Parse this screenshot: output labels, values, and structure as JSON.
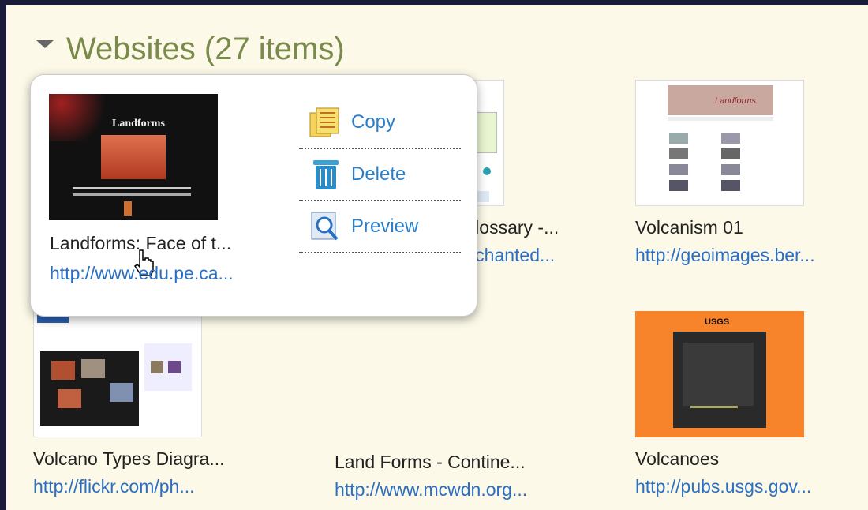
{
  "section": {
    "title": "Websites (27 items)"
  },
  "popup": {
    "title": "Landforms: Face of t...",
    "url": "http://www.edu.pe.ca...",
    "thumb_heading": "Landforms",
    "menu": [
      {
        "label": "Copy",
        "icon": "copy-icon"
      },
      {
        "label": "Delete",
        "icon": "trash-icon"
      },
      {
        "label": "Preview",
        "icon": "preview-icon"
      }
    ]
  },
  "items": [
    {
      "title": "...lossary -...",
      "url": "...chanted...",
      "thumb": "webpage-thumbnail"
    },
    {
      "title": "Volcanism 01",
      "url": "http://geoimages.ber...",
      "thumb": "webpage-thumbnail",
      "thumb_heading": "Landforms"
    },
    {
      "title": "Volcano Types Diagra...",
      "url": "http://flickr.com/ph...",
      "thumb": "flickr-thumbnail"
    },
    {
      "title": "Land Forms - Contine...",
      "url": "http://www.mcwdn.org...",
      "thumb": "none"
    },
    {
      "title": "Volcanoes",
      "url": "http://pubs.usgs.gov...",
      "thumb": "usgs-cover-thumbnail",
      "thumb_heading": "USGS"
    }
  ],
  "colors": {
    "title": "#7a8a4a",
    "link": "#2a6fc4",
    "background": "#fcf9e8"
  }
}
